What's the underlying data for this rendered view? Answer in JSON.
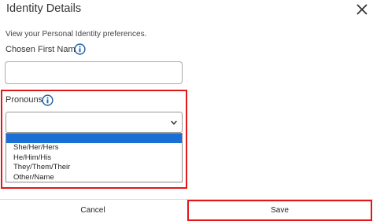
{
  "dialog": {
    "title": "Identity Details",
    "intro": "View your Personal Identity preferences."
  },
  "first_name": {
    "label": "Chosen First Name",
    "value": "",
    "placeholder": ""
  },
  "pronouns": {
    "label": "Pronouns",
    "selected_value": "",
    "options": [
      "",
      "She/Her/Hers",
      "He/Him/His",
      "They/Them/Their",
      "Other/Name"
    ]
  },
  "footer": {
    "cancel_label": "Cancel",
    "save_label": "Save"
  },
  "icons": {
    "close": "close-icon",
    "info": "info-icon",
    "chevron": "chevron-down-icon"
  },
  "colors": {
    "highlight": "#e01818",
    "info_blue": "#1f5fa8",
    "option_selected": "#1a6fd4"
  }
}
